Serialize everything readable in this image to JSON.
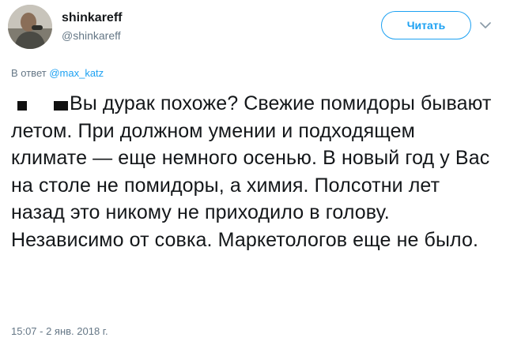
{
  "author": {
    "display_name": "shinkareff",
    "handle": "@shinkareff",
    "avatar_icon": "user-photo-avatar"
  },
  "actions": {
    "follow_label": "Читать",
    "menu_icon": "chevron-down-icon"
  },
  "reply": {
    "prefix": "В ответ",
    "mention": "@max_katz"
  },
  "tweet": {
    "text": "Вы дурак похоже? Свежие помидоры бывают летом. При должном умении и подходящем климате — еще немного осенью. В новый год у Вас на столе не помидоры, а химия. Полсотни лет назад это никому не приходило в голову. Независимо от совка. Маркетологов еще не было.",
    "timestamp": "15:07 - 2 янв. 2018 г."
  },
  "colors": {
    "accent": "#1da1f2",
    "text": "#14171a",
    "secondary": "#657786"
  }
}
